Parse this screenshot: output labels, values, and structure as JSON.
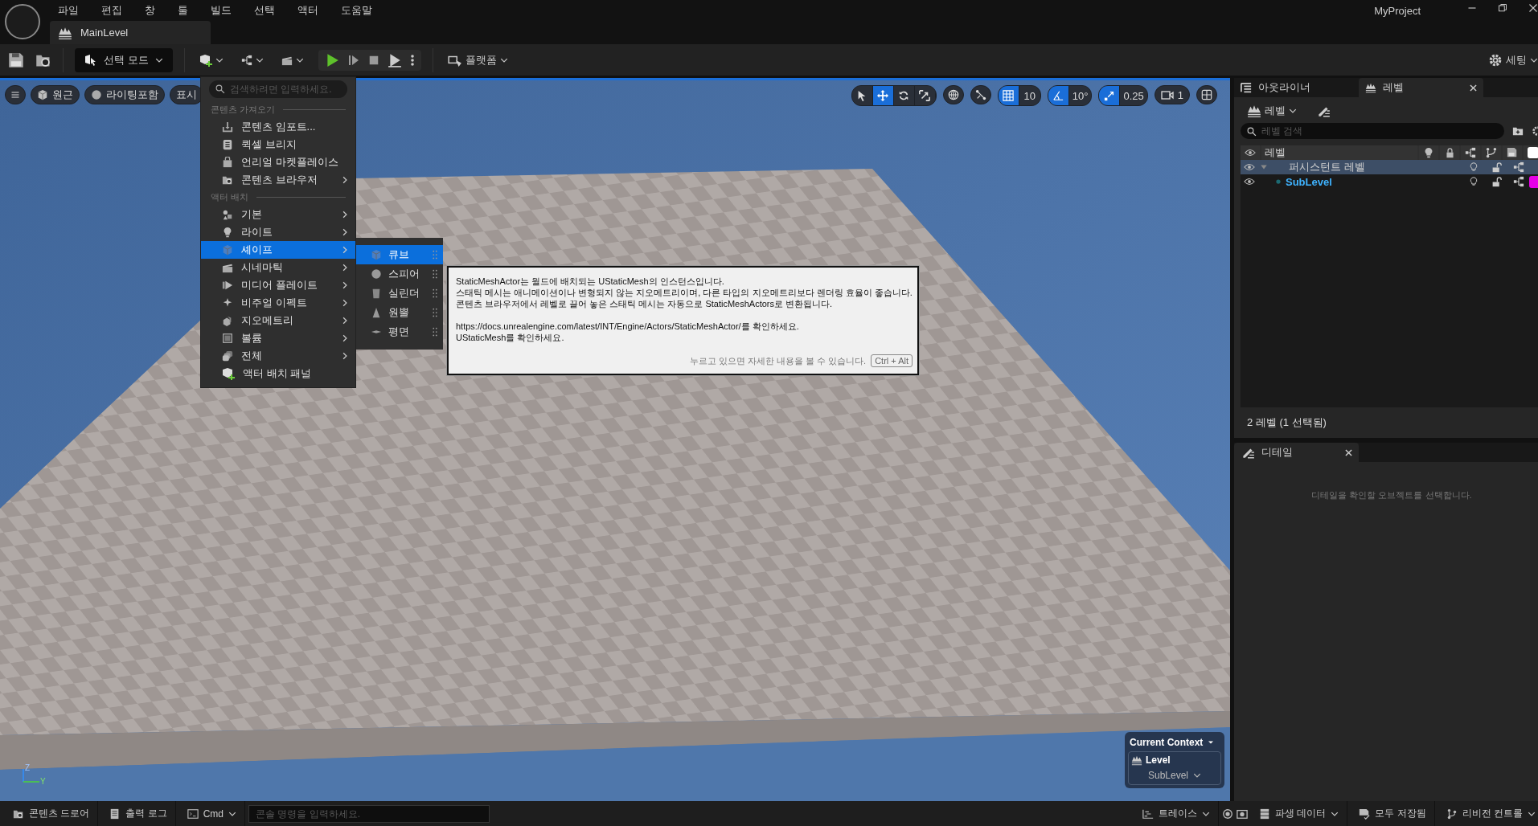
{
  "menu_bar": [
    "파일",
    "편집",
    "창",
    "툴",
    "빌드",
    "선택",
    "액터",
    "도움말"
  ],
  "window": {
    "title": "MyProject"
  },
  "document_tab": {
    "label": "MainLevel"
  },
  "toolbar": {
    "mode": "선택 모드",
    "platform": "플랫폼",
    "settings": "세팅"
  },
  "viewport": {
    "view_buttons": [
      {
        "label": "원근"
      },
      {
        "label": "라이팅포함"
      },
      {
        "label": "표시"
      }
    ],
    "tools": [
      {
        "kind": "select",
        "selected": false
      },
      {
        "kind": "translate",
        "selected": true
      },
      {
        "kind": "rotate",
        "selected": false
      },
      {
        "kind": "scale",
        "selected": false
      }
    ],
    "snaps": [
      {
        "kind": "grid",
        "value": "10",
        "on": true
      },
      {
        "kind": "angle",
        "value": "10°",
        "on": true
      },
      {
        "kind": "scale",
        "value": "0.25",
        "on": true
      }
    ],
    "camera_speed": "1",
    "axis": {
      "z": "Z",
      "y": "Y"
    },
    "context": {
      "title": "Current Context",
      "level_label": "Level",
      "level_value": "SubLevel"
    }
  },
  "add_menu": {
    "search_placeholder": "검색하려면 입력하세요.",
    "sections": [
      {
        "title": "콘텐츠 가져오기",
        "items": [
          {
            "label": "콘텐츠 임포트...",
            "submenu": false,
            "selected": false
          },
          {
            "label": "퀵셀 브리지",
            "submenu": false,
            "selected": false
          },
          {
            "label": "언리얼 마켓플레이스",
            "submenu": false,
            "selected": false
          },
          {
            "label": "콘텐츠 브라우저",
            "submenu": true,
            "selected": false
          }
        ]
      },
      {
        "title": "액터 배치",
        "items": [
          {
            "label": "기본",
            "submenu": true,
            "selected": false
          },
          {
            "label": "라이트",
            "submenu": true,
            "selected": false
          },
          {
            "label": "셰이프",
            "submenu": true,
            "selected": true
          },
          {
            "label": "시네마틱",
            "submenu": true,
            "selected": false
          },
          {
            "label": "미디어 플레이트",
            "submenu": true,
            "selected": false
          },
          {
            "label": "비주얼 이펙트",
            "submenu": true,
            "selected": false
          },
          {
            "label": "지오메트리",
            "submenu": true,
            "selected": false
          },
          {
            "label": "볼륨",
            "submenu": true,
            "selected": false
          },
          {
            "label": "전체",
            "submenu": true,
            "selected": false
          },
          {
            "label": "액터 배치 패널",
            "submenu": false,
            "selected": false
          }
        ]
      }
    ]
  },
  "shape_submenu": {
    "items": [
      {
        "label": "큐브",
        "kind": "cube",
        "selected": true
      },
      {
        "label": "스피어",
        "kind": "sphere",
        "selected": false
      },
      {
        "label": "실린더",
        "kind": "cylinder",
        "selected": false
      },
      {
        "label": "원뿔",
        "kind": "cone",
        "selected": false
      },
      {
        "label": "평면",
        "kind": "plane",
        "selected": false
      }
    ]
  },
  "tooltip": {
    "paragraphs": [
      "StaticMeshActor는 월드에 배치되는 UStaticMesh의 인스턴스입니다.\n스태틱 메시는 애니메이션이나 변형되지 않는 지오메트리이며, 다른 타입의 지오메트리보다 렌더링 효율이 좋습니다.\n콘텐츠 브라우저에서 레벨로 끌어 놓은 스태틱 메시는 자동으로 StaticMeshActors로 변환됩니다.",
      "https://docs.unrealengine.com/latest/INT/Engine/Actors/StaticMeshActor/를 확인하세요.\nUStaticMesh를 확인하세요."
    ],
    "hint": "누르고 있으면 자세한 내용을 볼 수 있습니다.",
    "shortcut": "Ctrl + Alt"
  },
  "levels_panel": {
    "tabs": [
      {
        "label": "아웃라이너",
        "selected": false
      },
      {
        "label": "레벨",
        "selected": true
      }
    ],
    "dropdown": "레벨",
    "search_placeholder": "레벨 검색",
    "header": "레벨",
    "rows": [
      {
        "name": "퍼시스턴트 레벨",
        "selected": true,
        "expanded": true,
        "current": false
      },
      {
        "name": "SubLevel",
        "selected": false,
        "current": true,
        "color": "#e600e6"
      }
    ],
    "footer": "2 레벨 (1 선택됨)"
  },
  "details_panel": {
    "tab": "디테일",
    "message": "디테일을 확인할 오브젝트를 선택합니다."
  },
  "status_bar": {
    "left": [
      {
        "kind": "drawer",
        "label": "콘텐츠 드로어"
      },
      {
        "kind": "log",
        "label": "출력 로그"
      },
      {
        "kind": "cmd",
        "label": "Cmd"
      }
    ],
    "console_placeholder": "콘솔 명령을 입력하세요.",
    "right": [
      {
        "kind": "trace",
        "label": "트레이스"
      },
      {
        "kind": "ddc",
        "label": "파생 데이터"
      },
      {
        "kind": "save",
        "label": "모두 저장됨"
      },
      {
        "kind": "revision",
        "label": "리비전 컨트롤"
      }
    ]
  }
}
